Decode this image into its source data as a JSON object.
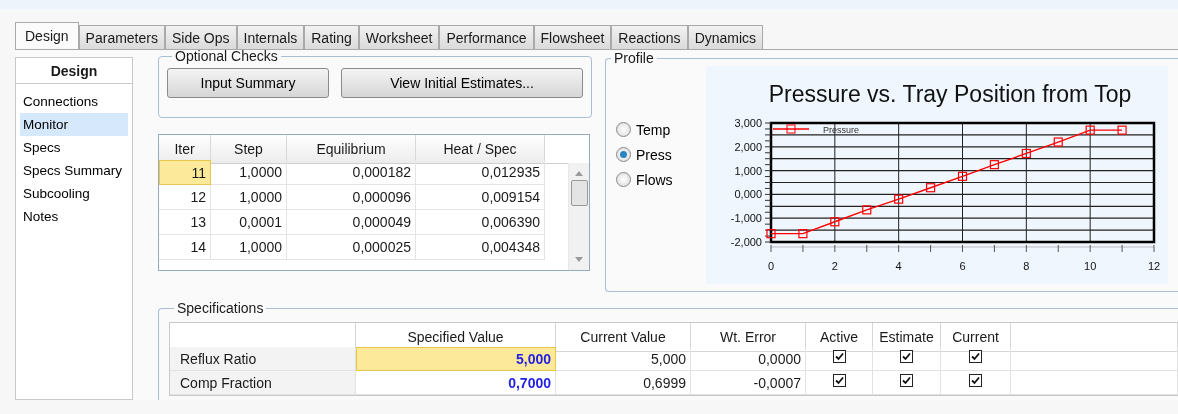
{
  "tabs": [
    {
      "label": "Design",
      "selected": true
    },
    {
      "label": "Parameters",
      "selected": false
    },
    {
      "label": "Side Ops",
      "selected": false
    },
    {
      "label": "Internals",
      "selected": false
    },
    {
      "label": "Rating",
      "selected": false
    },
    {
      "label": "Worksheet",
      "selected": false
    },
    {
      "label": "Performance",
      "selected": false
    },
    {
      "label": "Flowsheet",
      "selected": false
    },
    {
      "label": "Reactions",
      "selected": false
    },
    {
      "label": "Dynamics",
      "selected": false
    }
  ],
  "sidebar": {
    "title": "Design",
    "items": [
      {
        "label": "Connections",
        "selected": false
      },
      {
        "label": "Monitor",
        "selected": true
      },
      {
        "label": "Specs",
        "selected": false
      },
      {
        "label": "Specs Summary",
        "selected": false
      },
      {
        "label": "Subcooling",
        "selected": false
      },
      {
        "label": "Notes",
        "selected": false
      }
    ]
  },
  "optional_checks": {
    "title": "Optional Checks",
    "buttons": [
      "Input Summary",
      "View Initial Estimates..."
    ]
  },
  "iterations": {
    "columns": [
      "Iter",
      "Step",
      "Equilibrium",
      "Heat / Spec"
    ],
    "rows": [
      {
        "cells": [
          "11",
          "1,0000",
          "0,000182",
          "0,012935"
        ],
        "selected": true
      },
      {
        "cells": [
          "12",
          "1,0000",
          "0,000096",
          "0,009154"
        ],
        "selected": false
      },
      {
        "cells": [
          "13",
          "0,0001",
          "0,000049",
          "0,006390"
        ],
        "selected": false
      },
      {
        "cells": [
          "14",
          "1,0000",
          "0,000025",
          "0,004348"
        ],
        "selected": false
      }
    ]
  },
  "profile": {
    "title": "Profile",
    "options": [
      {
        "label": "Temp",
        "selected": false
      },
      {
        "label": "Press",
        "selected": true
      },
      {
        "label": "Flows",
        "selected": false
      }
    ],
    "chart_data": {
      "type": "line",
      "title": "Pressure vs. Tray Position from Top",
      "x": [
        0,
        1,
        2,
        3,
        4,
        5,
        6,
        7,
        8,
        9,
        10,
        11
      ],
      "grid": true,
      "series": [
        {
          "name": "Pressure",
          "color": "#ff0000",
          "marker": "square",
          "values": [
            -1.65,
            -1.65,
            -1.15,
            -0.65,
            -0.2,
            0.28,
            0.76,
            1.25,
            1.72,
            2.2,
            2.7,
            2.7
          ]
        }
      ],
      "xlim": [
        0,
        12
      ],
      "ylim": [
        -2,
        3
      ],
      "xticks": [
        0,
        2,
        4,
        6,
        8,
        10,
        12
      ],
      "yticks": [
        {
          "value": -2,
          "label": "-2,000"
        },
        {
          "value": -1,
          "label": "-1,000"
        },
        {
          "value": 0,
          "label": "0,000"
        },
        {
          "value": 1,
          "label": "1,000"
        },
        {
          "value": 2,
          "label": "2,000"
        },
        {
          "value": 3,
          "label": "3,000"
        }
      ]
    }
  },
  "specifications": {
    "title": "Specifications",
    "columns": [
      "Specified Value",
      "Current Value",
      "Wt. Error",
      "Active",
      "Estimate",
      "Current"
    ],
    "rows": [
      {
        "name": "Reflux Ratio",
        "specified_value": "5,000",
        "selected": true,
        "current_value": "5,000",
        "wt_error": "0,0000",
        "active": true,
        "estimate": true,
        "current": true
      },
      {
        "name": "Comp Fraction",
        "specified_value": "0,7000",
        "selected": false,
        "current_value": "0,6999",
        "wt_error": "-0,0007",
        "active": true,
        "estimate": true,
        "current": true
      }
    ]
  }
}
